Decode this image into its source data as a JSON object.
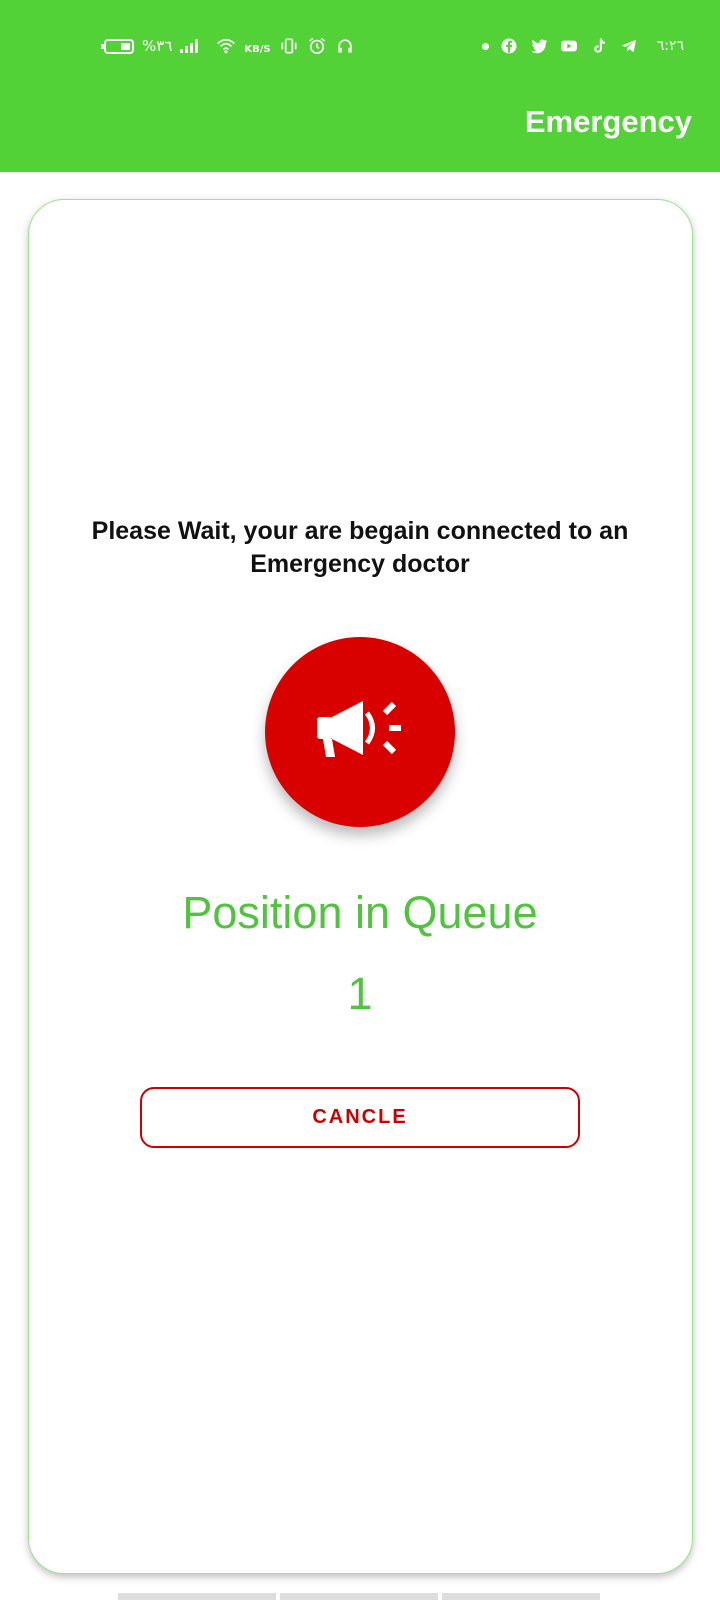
{
  "status_bar": {
    "battery_text": "%٣٦",
    "network_speed": "KB/S",
    "time": "٦:٢٦",
    "icons_left": [
      "battery-icon",
      "signal-icon",
      "wifi-icon",
      "vibrate-icon",
      "alarm-icon",
      "headset-icon"
    ],
    "icons_right": [
      "dot-icon",
      "facebook-icon",
      "twitter-icon",
      "youtube-icon",
      "tiktok-icon",
      "telegram-icon"
    ]
  },
  "header": {
    "title": "Emergency"
  },
  "main": {
    "message": "Please Wait, your are begain connected to an Emergency doctor",
    "alert_icon": "megaphone-icon",
    "queue_label": "Position in Queue",
    "queue_position": "1",
    "cancel_label": "CANCLE"
  },
  "colors": {
    "header_green": "#52d236",
    "queue_green": "#52c33e",
    "alert_red": "#d90000",
    "cancel_red": "#cc0000"
  }
}
